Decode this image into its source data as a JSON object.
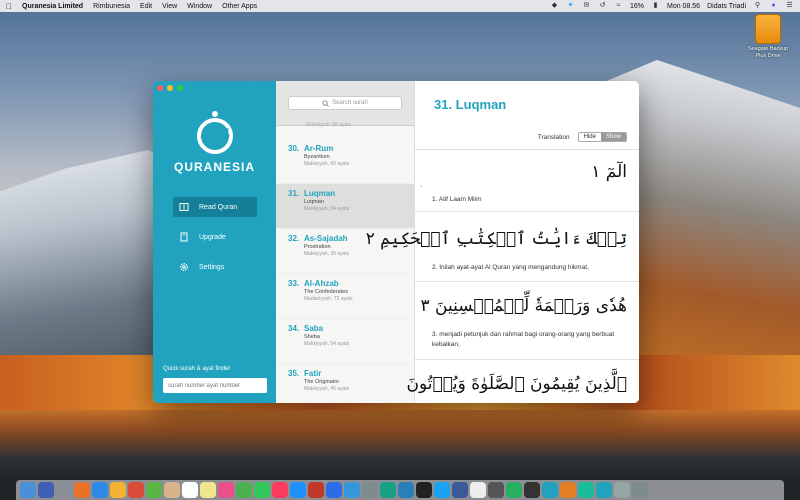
{
  "menubar": {
    "app_name": "Quranesia Limited",
    "menus": [
      "Rimbunesia",
      "Edit",
      "View",
      "Window",
      "Other Apps"
    ],
    "battery": "16%",
    "clock": "Mon 08.56",
    "user": "Didats Triadi"
  },
  "desktop": {
    "drive_label": "Seagate Backup Plus Drive"
  },
  "sidebar": {
    "brand": "QURANESIA",
    "nav": [
      {
        "label": "Read Quran",
        "icon": "book-icon"
      },
      {
        "label": "Upgrade",
        "icon": "upgrade-icon"
      },
      {
        "label": "Settings",
        "icon": "gear-icon"
      }
    ],
    "finder_label": "Quick surah & ayat finder",
    "finder_placeholder": "surah number:ayat number"
  },
  "list": {
    "search_placeholder": "Search surah",
    "partial_item": "Makkiyyah, 60 ayats",
    "surahs": [
      {
        "num": "30.",
        "name": "Ar-Rum",
        "meaning": "Byzantium",
        "meta": "Makkiyyah, 60 ayats"
      },
      {
        "num": "31.",
        "name": "Luqman",
        "meaning": "Luqman",
        "meta": "Makkiyyah, 34 ayats"
      },
      {
        "num": "32.",
        "name": "As-Sajadah",
        "meaning": "Prostration",
        "meta": "Makkiyyah, 30 ayats"
      },
      {
        "num": "33.",
        "name": "Al-Ahzab",
        "meaning": "The Confederates",
        "meta": "Madaniyyah, 73 ayats"
      },
      {
        "num": "34.",
        "name": "Saba",
        "meaning": "Sheba",
        "meta": "Makkiyyah, 54 ayats"
      },
      {
        "num": "35.",
        "name": "Fatir",
        "meaning": "The Originator",
        "meta": "Makkiyyah, 45 ayats"
      }
    ]
  },
  "main": {
    "title": "31. Luqman",
    "translation_label": "Translation",
    "toggle_hide": "Hide",
    "toggle_show": "Show",
    "marker": "ۡ",
    "ayahs": [
      {
        "arabic": "الٓمٓ ١",
        "translation": "1. Alif Laam Miim"
      },
      {
        "arabic": "تِلۡكَ ءَايَٰتُ ٱلۡكِتَٰبِ ٱلۡحَكِيمِ ٢",
        "translation": "2. Inilah ayat-ayat Al Quran yang mengandung hikmat,"
      },
      {
        "arabic": "هُدٗى وَرَحۡمَةٗ لِّلۡمُحۡسِنِينَ ٣",
        "translation": "3. menjadi petunjuk dan rahmat bagi orang-orang yang berbuat kebaikan,"
      },
      {
        "arabic": "ٱلَّذِينَ يُقِيمُونَ ٱلصَّلَوٰةَ وَيُؤۡتُونَ",
        "translation": ""
      }
    ]
  }
}
